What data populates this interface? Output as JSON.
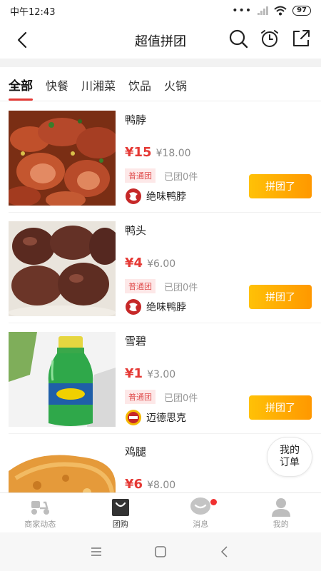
{
  "status": {
    "time": "中午12:43",
    "battery": "97"
  },
  "nav": {
    "title": "超值拼团"
  },
  "tabs": [
    "全部",
    "快餐",
    "川湘菜",
    "饮品",
    "火锅"
  ],
  "items": [
    {
      "name": "鸭脖",
      "price": "¥15",
      "old_price": "¥18.00",
      "badge": "普通团",
      "sold": "已团0件",
      "merchant": "绝味鸭脖",
      "button": "拼团了"
    },
    {
      "name": "鸭头",
      "price": "¥4",
      "old_price": "¥6.00",
      "badge": "普通团",
      "sold": "已团0件",
      "merchant": "绝味鸭脖",
      "button": "拼团了"
    },
    {
      "name": "雪碧",
      "price": "¥1",
      "old_price": "¥3.00",
      "badge": "普通团",
      "sold": "已团0件",
      "merchant": "迈德思克",
      "button": "拼团了"
    },
    {
      "name": "鸡腿",
      "price": "¥6",
      "old_price": "¥8.00",
      "badge": "",
      "sold": "",
      "merchant": "",
      "button": ""
    }
  ],
  "float_button": {
    "line1": "我的",
    "line2": "订单"
  },
  "bottom_tabs": [
    {
      "label": "商家动态",
      "icon": "scooter-icon"
    },
    {
      "label": "团购",
      "icon": "shopping-bag-icon"
    },
    {
      "label": "消息",
      "icon": "message-icon"
    },
    {
      "label": "我的",
      "icon": "person-icon"
    }
  ],
  "colors": {
    "accent": "#e53935",
    "button_start": "#ffc107",
    "button_end": "#ff9800"
  }
}
